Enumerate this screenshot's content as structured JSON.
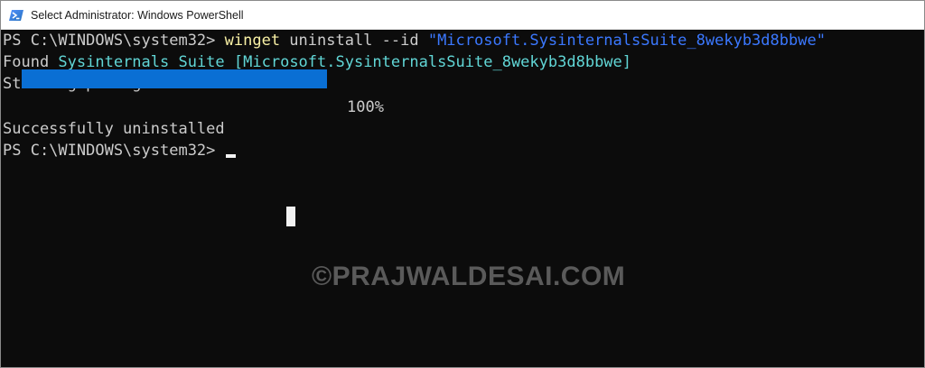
{
  "window": {
    "title": "Select Administrator: Windows PowerShell",
    "icon": "powershell-icon"
  },
  "console": {
    "line1": {
      "prompt": "PS C:\\WINDOWS\\system32> ",
      "command": "winget",
      "args": " uninstall --id ",
      "string": "\"Microsoft.SysinternalsSuite_8wekyb3d8bbwe\""
    },
    "line2": {
      "prefix": "Found ",
      "name": "Sysinternals Suite",
      "sep": " ",
      "id": "[Microsoft.SysinternalsSuite_8wekyb3d8bbwe]"
    },
    "line3": "Starting package uninstall...",
    "progress": {
      "percent": 100,
      "label": "100%",
      "color": "#0a6fd4"
    },
    "line5": "Successfully uninstalled",
    "line6": {
      "prompt": "PS C:\\WINDOWS\\system32> "
    }
  },
  "watermark": "©PRAJWALDESAI.COM",
  "colors": {
    "background": "#0c0c0c",
    "foreground": "#cccccc",
    "command": "#f9f1a5",
    "string": "#3b78ff",
    "highlight": "#61d6d6"
  }
}
